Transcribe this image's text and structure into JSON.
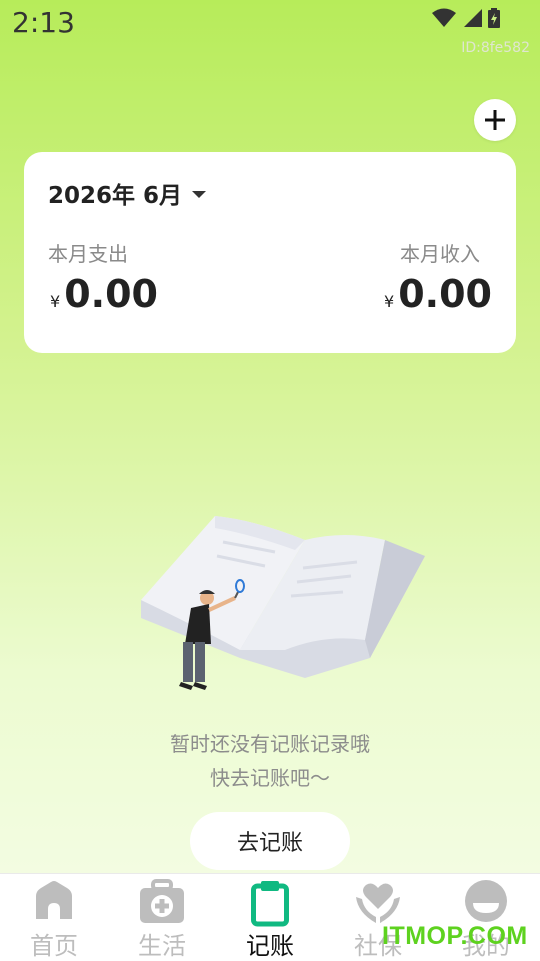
{
  "status_bar": {
    "time": "2:13",
    "id_text": "ID:8fe582"
  },
  "header": {
    "add_icon": "plus-icon"
  },
  "summary": {
    "month": "2026年 6月",
    "expense_label": "本月支出",
    "income_label": "本月收入",
    "currency": "¥",
    "expense_amount": "0.00",
    "income_amount": "0.00"
  },
  "empty_state": {
    "line1": "暂时还没有记账记录哦",
    "line2": "快去记账吧～",
    "button_label": "去记账"
  },
  "nav": {
    "items": [
      {
        "label": "首页",
        "icon": "home-icon",
        "active": false
      },
      {
        "label": "生活",
        "icon": "medical-kit-icon",
        "active": false
      },
      {
        "label": "记账",
        "icon": "clipboard-icon",
        "active": true
      },
      {
        "label": "社保",
        "icon": "heart-hands-icon",
        "active": false
      },
      {
        "label": "我的",
        "icon": "profile-icon",
        "active": false
      }
    ]
  },
  "watermark": "ITMOP.COM",
  "colors": {
    "accent": "#10b981",
    "bg_top": "#b7ec5a",
    "inactive_icon": "#bdbdbd"
  }
}
